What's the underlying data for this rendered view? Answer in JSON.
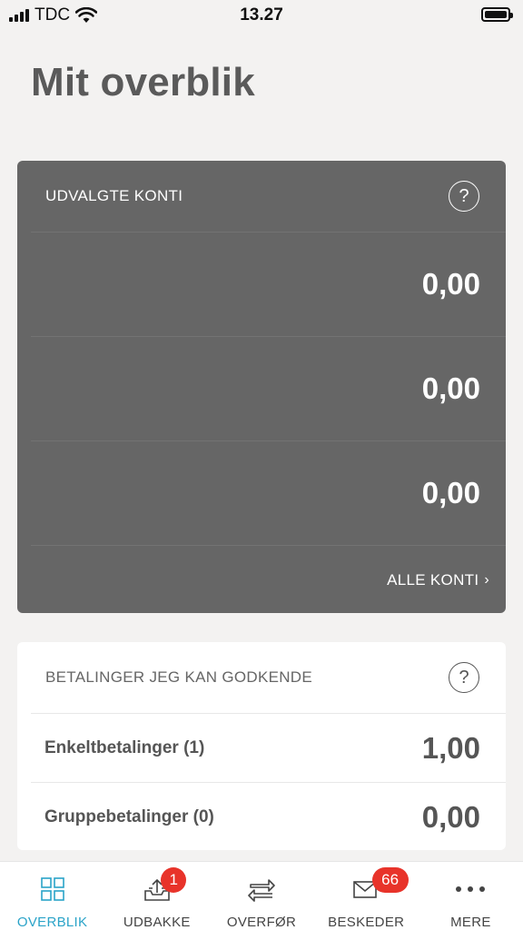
{
  "status_bar": {
    "carrier": "TDC",
    "time": "13.27"
  },
  "page": {
    "title": "Mit overblik"
  },
  "accounts": {
    "title": "UDVALGTE KONTI",
    "rows": [
      {
        "amount": "0,00"
      },
      {
        "amount": "0,00"
      },
      {
        "amount": "0,00"
      }
    ],
    "all_link": "ALLE KONTI"
  },
  "payments": {
    "title": "BETALINGER JEG KAN GODKENDE",
    "rows": [
      {
        "label": "Enkeltbetalinger (1)",
        "amount": "1,00"
      },
      {
        "label": "Gruppebetalinger (0)",
        "amount": "0,00"
      }
    ]
  },
  "tabbar": {
    "tabs": [
      {
        "label": "OVERBLIK",
        "icon": "grid-icon",
        "active": true
      },
      {
        "label": "UDBAKKE",
        "icon": "outbox-icon",
        "badge": "1"
      },
      {
        "label": "OVERFØR",
        "icon": "transfer-icon"
      },
      {
        "label": "BESKEDER",
        "icon": "mail-icon",
        "badge": "66"
      },
      {
        "label": "MERE",
        "icon": "more-icon"
      }
    ]
  },
  "colors": {
    "accent": "#2aa3c8",
    "card_dark": "#666666",
    "badge": "#e8332a"
  }
}
